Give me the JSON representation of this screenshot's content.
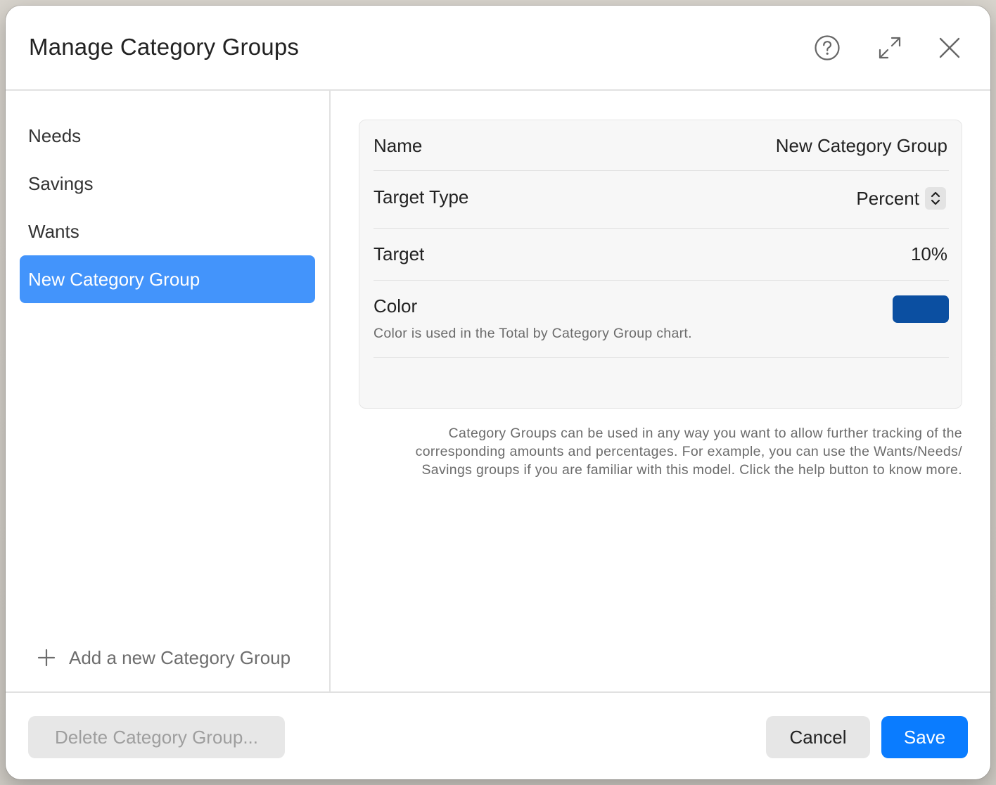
{
  "dialog": {
    "title": "Manage Category Groups"
  },
  "sidebar": {
    "items": [
      {
        "label": "Needs"
      },
      {
        "label": "Savings"
      },
      {
        "label": "Wants"
      },
      {
        "label": "New Category Group",
        "selected": true
      }
    ],
    "add_label": "Add a new Category Group"
  },
  "form": {
    "name_label": "Name",
    "name_value": "New Category Group",
    "target_type_label": "Target Type",
    "target_type_value": "Percent",
    "target_label": "Target",
    "target_value": "10%",
    "color_label": "Color",
    "color_hint": "Color is used in the Total by Category Group chart.",
    "color_value": "#0b4fa1",
    "footnote": "Category Groups can be used in any way you want to allow further tracking of the corresponding amounts and percentages. For example, you can use the Wants/Needs/ Savings groups if you are familiar with this model. Click the help button to know more."
  },
  "footer": {
    "delete_label": "Delete Category Group...",
    "cancel_label": "Cancel",
    "save_label": "Save"
  },
  "icons": {
    "help": "question-circle-icon",
    "expand": "expand-arrows-icon",
    "close": "close-icon",
    "add": "plus-icon",
    "stepper": "chevron-up-down-icon"
  },
  "colors": {
    "accent": "#0a7cff",
    "selection": "#4394fb"
  }
}
